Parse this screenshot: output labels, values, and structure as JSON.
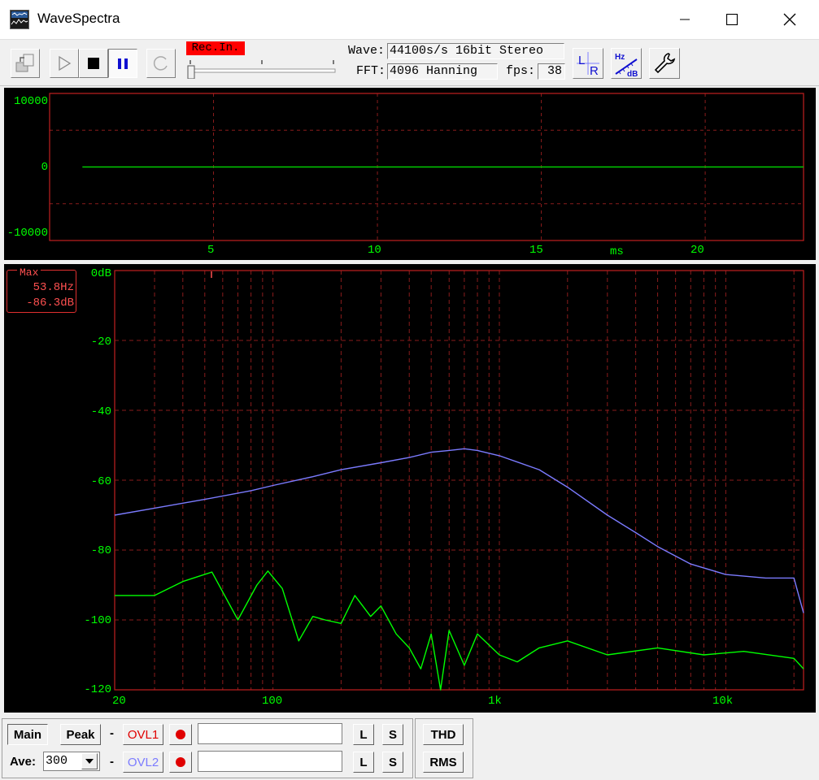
{
  "window": {
    "title": "WaveSpectra"
  },
  "toolbar": {
    "rec_in_label": "Rec.In.",
    "wave_label": "Wave:",
    "wave_value": "44100s/s 16bit Stereo",
    "fft_label": "FFT:",
    "fft_value": "4096 Hanning",
    "fps_label": "fps:",
    "fps_value": "38",
    "rec_level": 0.0,
    "lr_icon_text_l": "L",
    "lr_icon_text_r": "R",
    "hzdb_icon_text_hz": "Hz",
    "hzdb_icon_text_db": "dB"
  },
  "wave_chart": {
    "type": "line",
    "y_ticks": [
      "10000",
      "0",
      "-10000"
    ],
    "x_ticks": [
      "5",
      "10",
      "15",
      "20"
    ],
    "x_unit": "ms",
    "ylim": [
      -10000,
      10000
    ],
    "xlim": [
      0,
      23
    ]
  },
  "spectrum_chart": {
    "type": "line",
    "y_ticks": [
      "0dB",
      "-20",
      "-40",
      "-60",
      "-80",
      "-100",
      "-120"
    ],
    "x_ticks": [
      "20",
      "100",
      "1k",
      "10k"
    ],
    "ylim": [
      -120,
      0
    ],
    "xlim": [
      20,
      22050
    ],
    "x_scale": "log",
    "max_box": {
      "title": "Max",
      "freq": "53.8Hz",
      "level": "-86.3dB"
    }
  },
  "chart_data": [
    {
      "type": "line",
      "x": [
        1,
        23
      ],
      "series": [
        {
          "values": [
            0,
            0
          ],
          "color": "#00cc00"
        }
      ],
      "ylim": [
        -10000,
        10000
      ],
      "xlim": [
        0,
        23
      ],
      "grid": true
    },
    {
      "type": "line",
      "x_scale": "log",
      "xlim": [
        20,
        22050
      ],
      "ylim": [
        -120,
        0
      ],
      "grid": true,
      "series": [
        {
          "color": "#7b7bff",
          "x": [
            20,
            30,
            50,
            80,
            100,
            150,
            200,
            300,
            400,
            500,
            600,
            700,
            800,
            1000,
            1500,
            2000,
            3000,
            4000,
            5000,
            7000,
            10000,
            15000,
            20000,
            22050
          ],
          "values": [
            -70,
            -68,
            -65.5,
            -63,
            -61.5,
            -59,
            -57,
            -55,
            -53.5,
            -52,
            -51.5,
            -51,
            -51.5,
            -53,
            -57,
            -62,
            -70,
            -75,
            -79,
            -84,
            -87,
            -88,
            -88,
            -98
          ]
        },
        {
          "color": "#00ff00",
          "x": [
            20,
            30,
            40,
            53.8,
            70,
            85,
            95,
            110,
            130,
            150,
            170,
            200,
            230,
            270,
            300,
            350,
            400,
            450,
            500,
            550,
            600,
            700,
            800,
            1000,
            1200,
            1500,
            2000,
            3000,
            5000,
            8000,
            12000,
            20000,
            22050
          ],
          "values": [
            -93,
            -93,
            -89,
            -86.3,
            -100,
            -90,
            -86,
            -91,
            -106,
            -99,
            -100,
            -101,
            -93,
            -99,
            -96,
            -104,
            -108,
            -114,
            -104,
            -120,
            -103,
            -113,
            -104,
            -110,
            -112,
            -108,
            -106,
            -110,
            -108,
            -110,
            -109,
            -111,
            -114
          ]
        }
      ]
    }
  ],
  "bottom": {
    "main_label": "Main",
    "peak_label": "Peak",
    "dash": "-",
    "ovl1_label": "OVL1",
    "ovl2_label": "OVL2",
    "ovl1_color": "#e00000",
    "ovl2_color": "#7b7bff",
    "l_label": "L",
    "s_label": "S",
    "thd_label": "THD",
    "rms_label": "RMS",
    "ave_label": "Ave:",
    "ave_value": "300"
  }
}
